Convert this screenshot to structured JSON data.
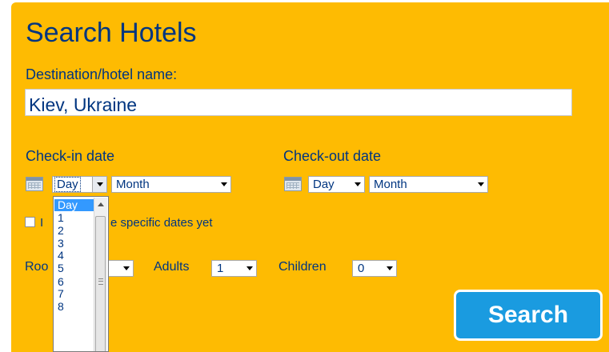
{
  "title": "Search Hotels",
  "destination": {
    "label": "Destination/hotel name:",
    "value": "Kiev, Ukraine"
  },
  "checkin": {
    "label": "Check-in date",
    "day": "Day",
    "month": "Month"
  },
  "checkout": {
    "label": "Check-out date",
    "day": "Day",
    "month": "Month"
  },
  "flexible": {
    "text_start": "I",
    "text_end": "e specific dates yet"
  },
  "rooms": {
    "label": "Roo"
  },
  "adults": {
    "label": "Adults",
    "value": "1"
  },
  "children": {
    "label": "Children",
    "value": "0"
  },
  "search_label": "Search",
  "day_dropdown": {
    "options": [
      "Day",
      "1",
      "2",
      "3",
      "4",
      "5",
      "6",
      "7",
      "8"
    ],
    "selected": "Day"
  },
  "colors": {
    "panel": "#febb02",
    "text": "#003580",
    "button": "#1a9be0",
    "selected_option": "#3399ff"
  },
  "icons": [
    "calendar-icon",
    "chevron-down-icon",
    "scroll-up-icon"
  ]
}
